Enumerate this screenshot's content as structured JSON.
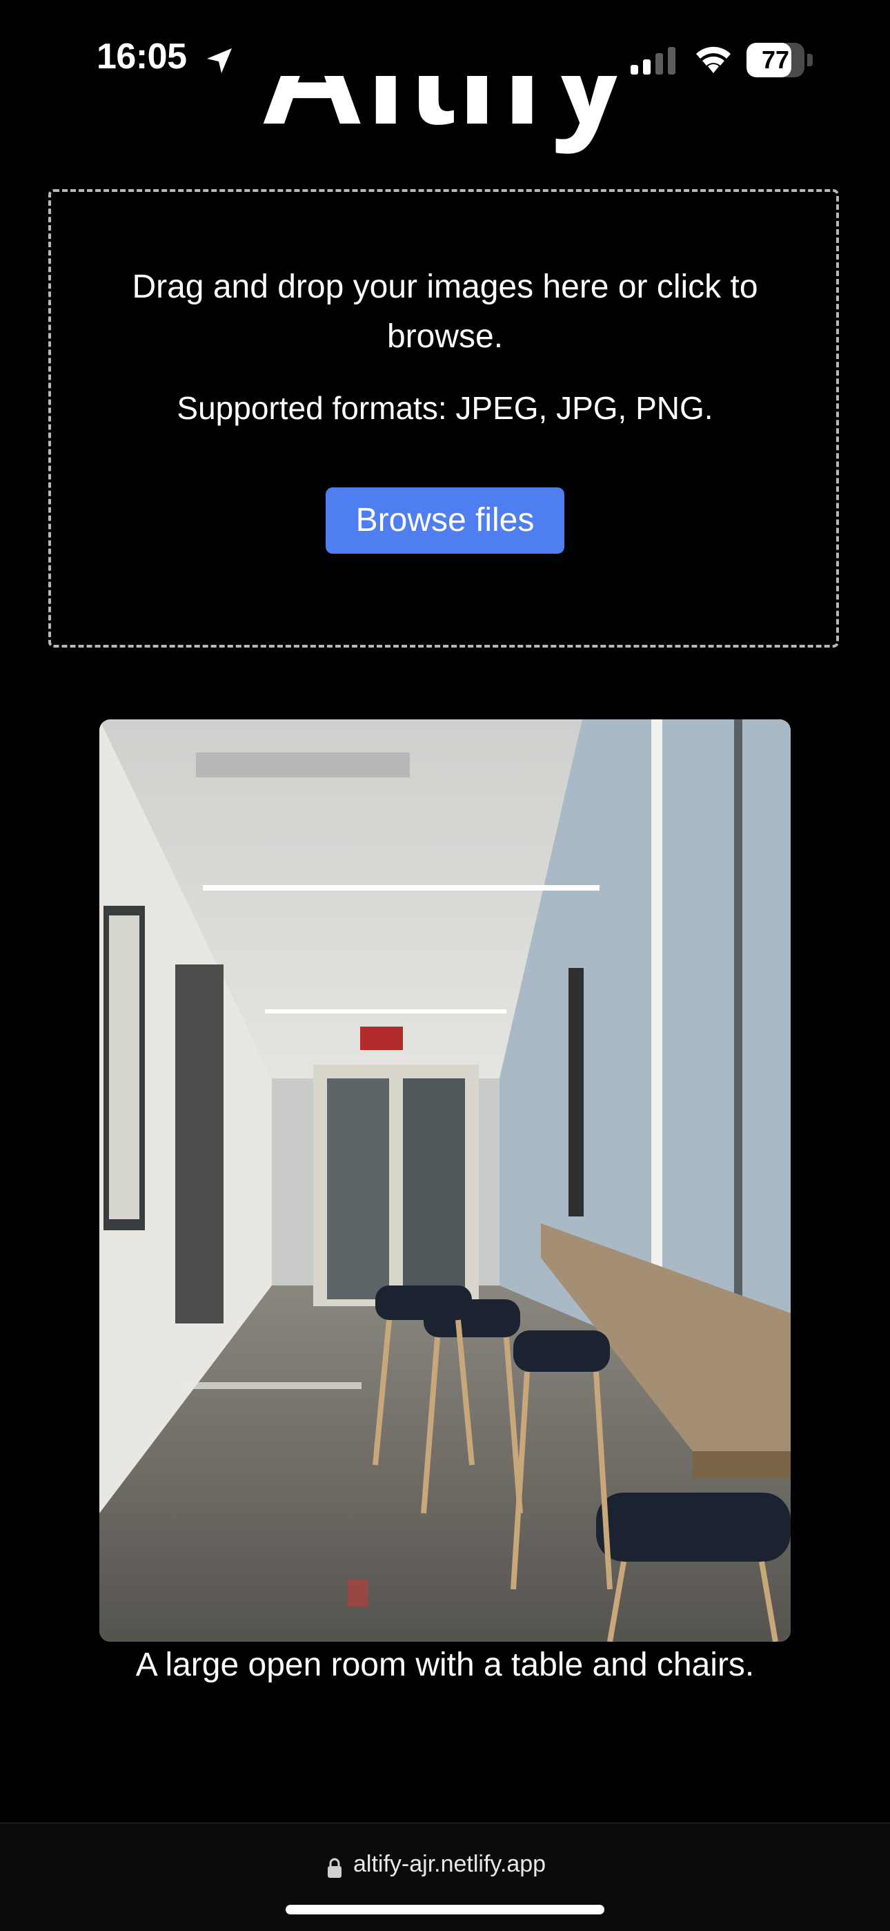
{
  "status_bar": {
    "time": "16:05",
    "battery_level": "77",
    "battery_fraction": 0.77,
    "icons": [
      "location-arrow-icon",
      "cellular-signal-icon",
      "wifi-icon",
      "battery-icon"
    ]
  },
  "header": {
    "logo_text": "Altify"
  },
  "upload": {
    "drop_text": "Drag and drop your images here or click to browse.",
    "formats_text": "Supported formats: JPEG, JPG, PNG.",
    "browse_label": "Browse files"
  },
  "result": {
    "caption": "A large open room with a table and chairs."
  },
  "browser": {
    "url": "altify-ajr.netlify.app",
    "lock_icon": "lock-icon"
  },
  "colors": {
    "background": "#000000",
    "accent_button": "#4f7ef0",
    "dashed_border": "#b8b8b8"
  }
}
